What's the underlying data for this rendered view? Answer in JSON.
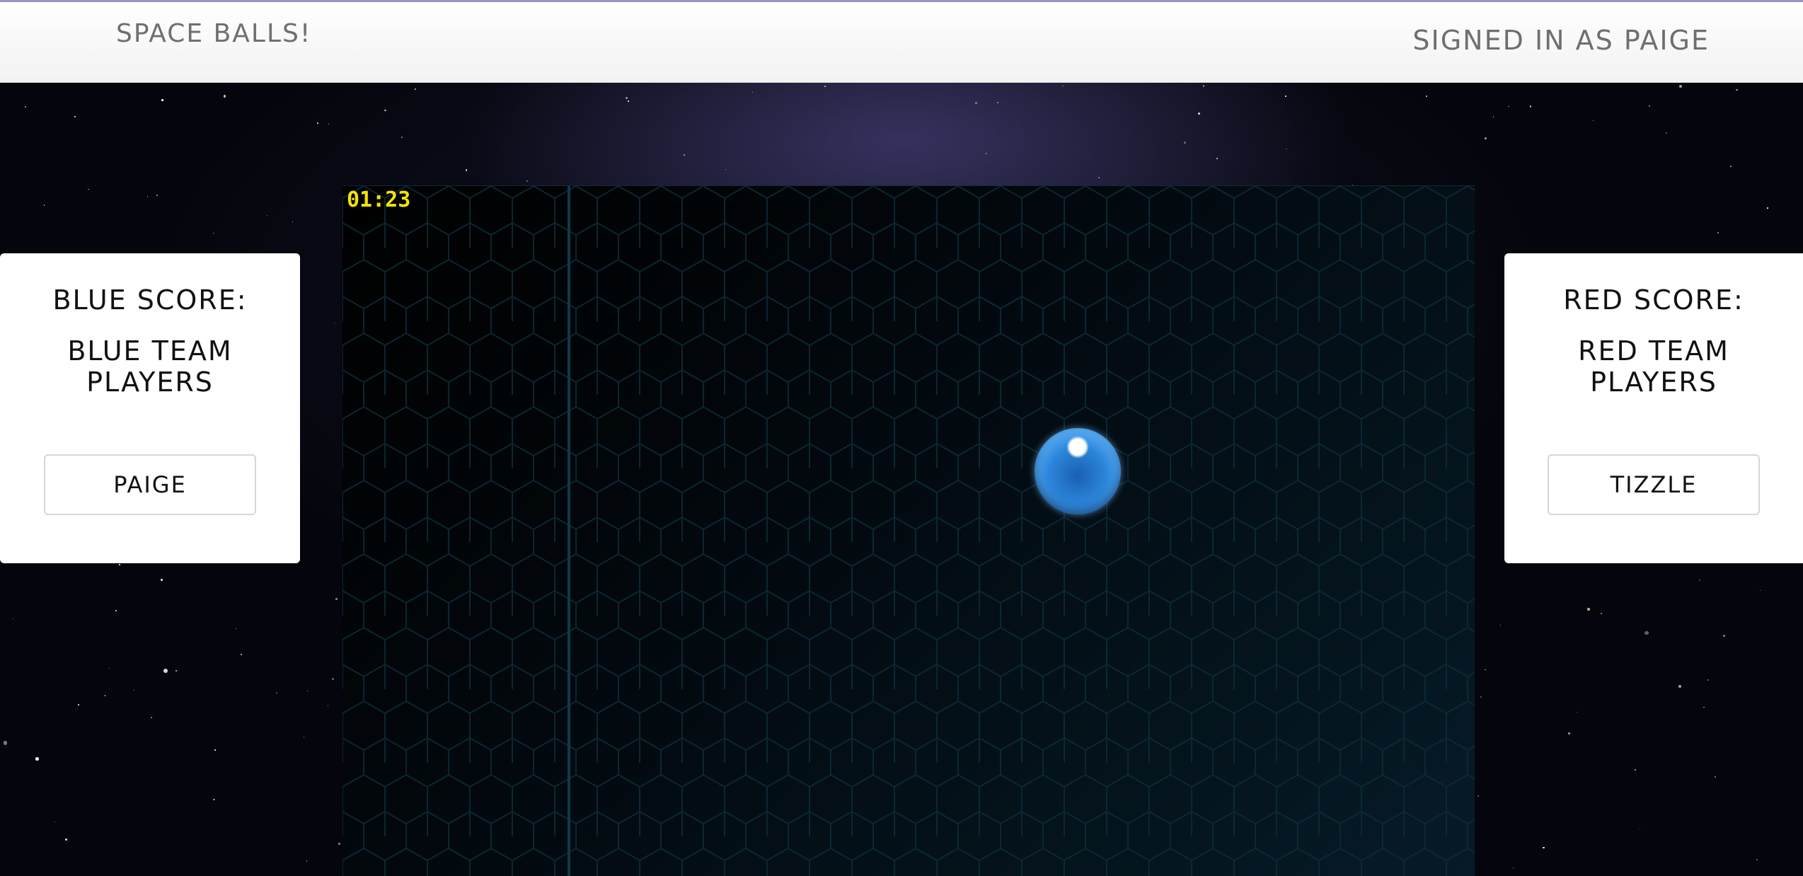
{
  "header": {
    "brand": "Space Balls!",
    "signed_in": "Signed in as Paige"
  },
  "blue_panel": {
    "score_label": "Blue Score:",
    "players_label": "Blue Team Players",
    "players": [
      "Paige"
    ]
  },
  "red_panel": {
    "score_label": "Red Score:",
    "players_label": "Red Team Players",
    "players": [
      "Tizzle"
    ]
  },
  "game": {
    "timer": "01:23"
  },
  "colors": {
    "timer": "#f2e400",
    "ball": "#2c86db",
    "field_lines": "#0e3a4a"
  }
}
